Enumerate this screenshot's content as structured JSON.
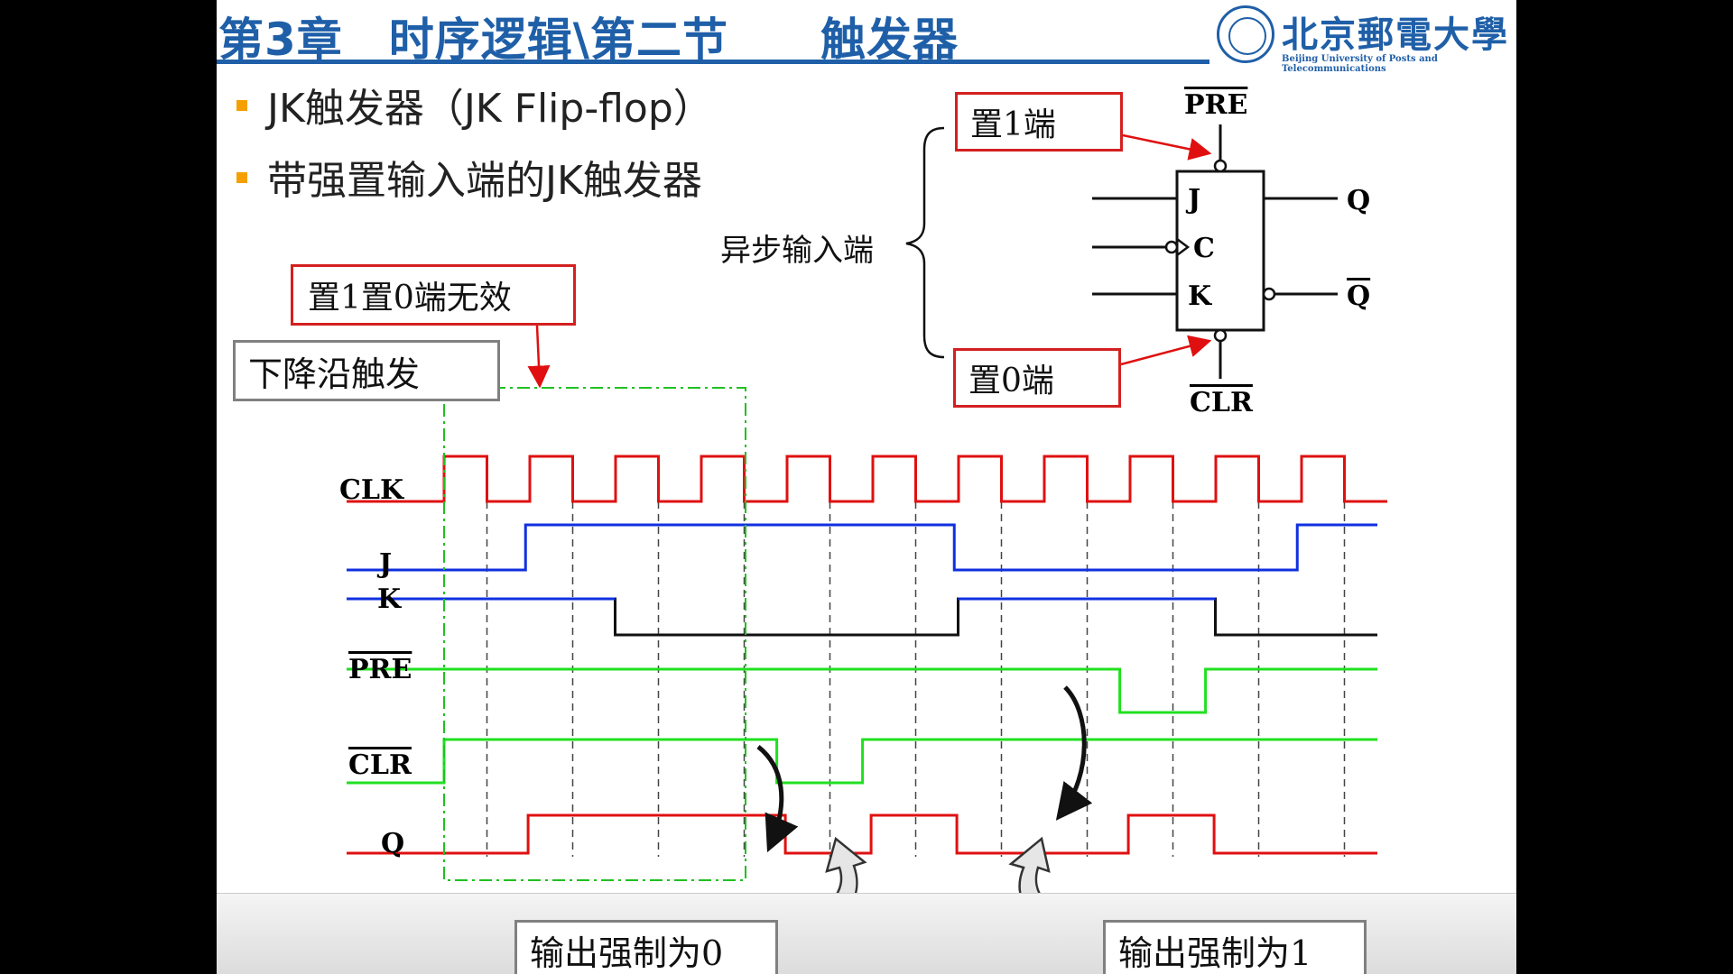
{
  "header": {
    "chapter_title": "第3章　时序逻辑\\第二节　　触发器",
    "logo_cn": "北京郵電大學",
    "logo_en": "Beijing University of Posts and Telecommunications"
  },
  "bullets": [
    "JK触发器（JK Flip-flop）",
    "带强置输入端的JK触发器"
  ],
  "symbol": {
    "pins": {
      "pre": "PRE",
      "clr": "CLR",
      "j": "J",
      "c": "C",
      "k": "K",
      "q": "Q",
      "qbar": "Q"
    },
    "set1_label": "置1端",
    "set0_label": "置0端",
    "async_label": "异步输入端"
  },
  "annotations": {
    "invalid_label": "置1置0端无效",
    "falling_edge_label": "下降沿触发",
    "force0_label": "输出强制为0",
    "force1_label": "输出强制为1"
  },
  "timing": {
    "signals": [
      "CLK",
      "J",
      "K",
      "PRE",
      "CLR",
      "Q"
    ],
    "clock_periods": 11,
    "J": [
      0,
      1,
      1,
      1,
      1,
      1,
      0,
      0,
      0,
      0,
      1
    ],
    "K": [
      1,
      1,
      0,
      0,
      0,
      0,
      1,
      1,
      1,
      0,
      0
    ],
    "PRE": [
      1,
      1,
      1,
      1,
      1,
      1,
      1,
      1,
      0,
      1,
      1
    ],
    "CLR": [
      1,
      1,
      1,
      1,
      0,
      1,
      1,
      1,
      1,
      1,
      1
    ],
    "Q": [
      0,
      1,
      1,
      1,
      0,
      1,
      0,
      0,
      1,
      0,
      0
    ]
  },
  "colors": {
    "title": "#1f5fa8",
    "red": "#e01010",
    "blue": "#1030e0",
    "green": "#20e020",
    "black": "#111111",
    "bullet": "#f5a000"
  }
}
